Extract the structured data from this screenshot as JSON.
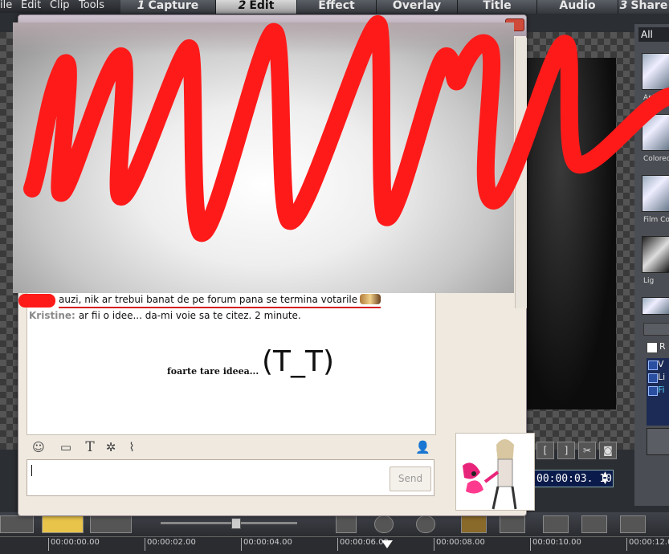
{
  "editor": {
    "menu": [
      "ile",
      "Edit",
      "Clip",
      "Tools"
    ],
    "steps": [
      {
        "num": "1",
        "label": "Capture"
      },
      {
        "num": "2",
        "label": "Edit"
      },
      {
        "num": "",
        "label": "Effect"
      },
      {
        "num": "",
        "label": "Overlay"
      },
      {
        "num": "",
        "label": "Title"
      },
      {
        "num": "",
        "label": "Audio"
      },
      {
        "num": "3",
        "label": "Share"
      }
    ],
    "library_filter": "All",
    "library_items": [
      "Apl",
      "Colored",
      "Film Co",
      "Lig"
    ],
    "fx_list": [
      "V",
      "Li",
      "Fi"
    ],
    "checkbox_label": "R",
    "timecode": "00:00:03. 10",
    "ruler_ticks": [
      "00:00:00.00",
      "00:00:02.00",
      "00:00:04.00",
      "00:00:06.00",
      "00:00:08.00",
      "00:00:10.00",
      "00:00:12.0"
    ]
  },
  "chat": {
    "message1_text": "auzi, nik ar trebui banat de pe forum pana se termina votarile",
    "message2_sender": "Kristine:",
    "message2_text": "ar fii o idee... da-mi voie sa te citez. 2 minute.",
    "drawing_text": "foarte tare ideea...",
    "drawing_emoticon": "(T_T)",
    "input_value": "",
    "send_label": "Send"
  },
  "colors": {
    "scribble": "#ff1a1a",
    "underline": "#d81e1e"
  }
}
